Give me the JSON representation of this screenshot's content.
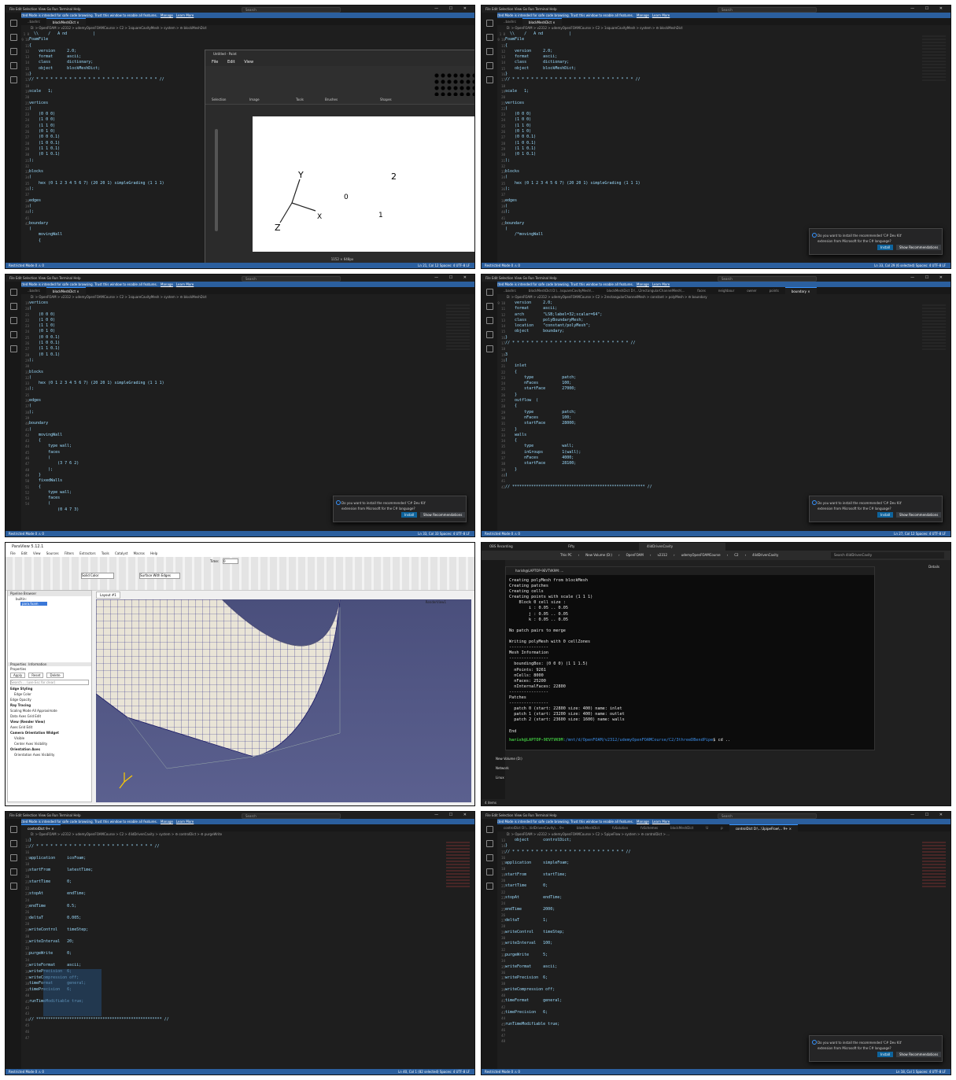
{
  "vscode": {
    "menu": "File  Edit  Selection  View  Go  Run  Terminal  Help",
    "search": "Search",
    "restricted": "Restricted Mode is intended for safe code browsing. Trust this window to enable all features.",
    "manage": "Manage",
    "learn_more": "Learn More",
    "status_left": "Restricted Mode   0 ⚠ 0",
    "toast_line1": "Do you want to install the recommended 'C# Dev Kit'",
    "toast_line2": "extension from Microsoft for the C# language?",
    "install": "Install",
    "show_recs": "Show Recommendations"
  },
  "p1": {
    "tabs": [
      "..bashrc",
      "blockMeshDict ×"
    ],
    "crumb": "D: > OpenFOAM > v2312 > udemyOpenFOAMCourse > C2 > 1squareCavityMesh > system > ⚙ blockMeshDict",
    "gutter": "1\n8\n9\n10\n11\n12\n13\n14\n15\n16\n17\n18\n19\n20\n21\n22\n23\n24\n25\n26\n27\n28\n29\n30\n31\n32\n33\n34\n35\n36\n37\n38\n39\n40\n41\n42",
    "code": "  \\\\    /   A nd           |\nFoamFile\n{\n    version     2.0;\n    format      ascii;\n    class       dictionary;\n    object      blockMeshDict;\n}\n// * * * * * * * * * * * * * * * * * * * * * * * * * * //\n\nscale   1;\n\nvertices\n(\n    (0 0 0)\n    (1 0 0)\n    (1 1 0)\n    (0 1 0)\n    (0 0 0.1)\n    (1 0 0.1)\n    (1 1 0.1)\n    (0 1 0.1)\n);\n\nblocks\n(\n    hex (0 1 2 3 4 5 6 7) (20 20 1) simpleGrading (1 1 1)\n);\n\nedges\n(\n);\n\nboundary\n(\n    movingWall\n    {",
    "status": "Ln 21, Col 12   Spaces: 4   UTF-8   LF",
    "paint_title": "Untitled - Paint",
    "paint_menu": "File  Edit  View",
    "paint_groups": [
      "Selection",
      "Image",
      "Tools",
      "Brushes",
      "Shapes"
    ],
    "paint_size": "1152 × 648px",
    "sketch_labels": [
      "Y",
      "Z",
      "X",
      "0",
      "1",
      "2"
    ]
  },
  "p2": {
    "tabs": [
      "..bashrc",
      "blockMeshDict ×"
    ],
    "crumb": "D: > OpenFOAM > v2312 > udemyOpenFOAMCourse > C2 > 1squareCavityMesh > system > ⚙ blockMeshDict",
    "gutter": "1\n8\n9\n10\n11\n12\n13\n14\n15\n16\n17\n18\n19\n20\n21\n22\n23\n24\n25\n26\n27\n28\n29\n30\n31\n32\n33\n34\n35\n36\n37\n38\n39\n40\n41\n42",
    "code": "  \\\\    /   A nd           |\nFoamFile\n{\n    version     2.0;\n    format      ascii;\n    class       dictionary;\n    object      blockMeshDict;\n}\n// * * * * * * * * * * * * * * * * * * * * * * * * * * //\n\nscale   1;\n\nvertices\n(\n    (0 0 0)\n    (1 0 0)\n    (1 1 0)\n    (0 1 0)\n    (0 0 0.1)\n    (1 0 0.1)\n    (1 1 0.1)\n    (0 1 0.1)\n);\n\nblocks\n(\n    hex (0 1 2 3 4 5 6 7) (20 20 1) simpleGrading (1 1 1)\n);\n\nedges\n(\n);\n\nboundary\n(\n    /*movingWall",
    "status": "Ln 33, Col 29 (6 selected)   Spaces: 4   UTF-8   LF"
  },
  "p3": {
    "tabs": [
      "..bashrc",
      "blockMeshDict ×"
    ],
    "crumb": "D: > OpenFOAM > v2312 > udemyOpenFOAMCourse > C2 > 1squareCavityMesh > system > ⚙ blockMeshDict",
    "gutter": "19\n20\n21\n22\n23\n24\n25\n26\n27\n28\n29\n30\n31\n32\n33\n34\n35\n36\n37\n38\n39\n40\n41\n42\n43\n44\n45\n46\n47\n48\n49\n50\n51\n52\n53\n54",
    "code": "vertices\n(\n    (0 0 0)\n    (1 0 0)\n    (1 1 0)\n    (0 1 0)\n    (0 0 0.1)\n    (1 0 0.1)\n    (1 1 0.1)\n    (0 1 0.1)\n);\n\nblocks\n(\n    hex (0 1 2 3 4 5 6 7) (20 20 1) simpleGrading (1 1 1)\n);\n\nedges\n(\n);\n\nboundary\n(\n    movingWall\n    {\n        type wall;\n        faces\n        (\n            (3 7 6 2)\n        );\n    }\n    fixedWalls\n    {\n        type wall;\n        faces\n        (\n            (0 4 7 3)",
    "status": "Ln 33, Col 33   Spaces: 4   UTF-8   LF"
  },
  "p4": {
    "tabs": [
      "..bashrc",
      "blockMeshDict D:\\...\\squareCavityMesh\\...",
      "blockMeshDict D:\\...\\2rectangularChannelMesh\\...",
      "faces",
      "neighbour",
      "owner",
      "points",
      "boundary ×"
    ],
    "crumb": "D: > OpenFOAM > v2312 > udemyOpenFOAMCourse > C2 > 2rectangularChannelMesh > constant > polyMesh > ⚙ boundary",
    "gutter": "9\n10\n11\n12\n13\n14\n15\n16\n17\n18\n19\n20\n21\n22\n23\n24\n25\n26\n27\n28\n29\n30\n31\n32\n33\n34\n35\n36\n37\n38\n39\n40\n41\n42",
    "code": "    version     2.0;\n    format      ascii;\n    arch        \"LSB;label=32;scalar=64\";\n    class       polyBoundaryMesh;\n    location    \"constant/polyMesh\";\n    object      boundary;\n}\n// * * * * * * * * * * * * * * * * * * * * * * * * * //\n\n3\n(\n    inlet\n    {\n        type            patch;\n        nFaces          100;\n        startFace       27000;\n    }\n    outflow  (\n    {\n        type            patch;\n        nFaces          100;\n        startFace       28000;\n    }\n    walls\n    {\n        type            wall;\n        inGroups        1(wall);\n        nFaces          4000;\n        startFace       28100;\n    }\n)\n\n// ******************************************************** //",
    "status": "Ln 27, Col 12   Spaces: 4   UTF-8   LF"
  },
  "p5": {
    "title": "ParaView 5.12.1",
    "menu": "File  Edit  View  Sources  Filters  Extractors  Tools  Catalyst  Macros  Help",
    "time_label": "Time:",
    "time_value": "0",
    "pipeline_header": "Pipeline Browser",
    "builtin": "builtin:",
    "source": "para.foam",
    "props_tab": "Properties",
    "info_tab": "Information",
    "props_label": "Properties",
    "apply": "Apply",
    "reset": "Reset",
    "delete": "Delete",
    "search_ph": "Search ... (use Esc for clear)",
    "rows": [
      "Edge Styling",
      "Edge Color",
      "Edge Opacity",
      "Ray Tracing",
      "Scaling Mode  All Approximate",
      "Data Axes Grid      Edit",
      "View (Render View)",
      "Axes Grid      Edit",
      "Camera Orientation Widget",
      "Visible",
      "Center Axes Visibility",
      "Orientation Axes",
      "Orientation Axes Visibility"
    ],
    "render_tab": "Layout #1",
    "render_view": "RenderView1",
    "repr": "Surface With Edges",
    "solid": "Solid Color"
  },
  "p6": {
    "explorer_tabs": [
      "OBS Recording",
      "Fifty",
      "4lidDrivenCavity"
    ],
    "crumb": [
      "This PC",
      "New Volume (D:)",
      "OpenFOAM",
      "v2312",
      "udemyOpenFOAMCourse",
      "C2",
      "4lidDrivenCavity"
    ],
    "search": "Search 4lidDrivenCavity",
    "details": "Details",
    "term_title": "harish@LAPTOP-9EVTVK9M: ...",
    "term_lines": "Creating polyMesh from blockMesh\nCreating patches\nCreating cells\nCreating points with scale (1 1 1)\n    Block 0 cell size :\n        i : 0.05 .. 0.05\n        j : 0.05 .. 0.05\n        k : 0.05 .. 0.05\n\nNo patch pairs to merge\n\nWriting polyMesh with 0 cellZones\n----------------\nMesh Information\n----------------\n  boundingBox: (0 0 0) (1 1 1.5)\n  nPoints: 9261\n  nCells: 8000\n  nFaces: 25200\n  nInternalFaces: 22800\n----------------\nPatches\n----------------\n  patch 0 (start: 22800 size: 400) name: inlet\n  patch 1 (start: 23200 size: 400) name: outlet\n  patch 2 (start: 23600 size: 1600) name: walls\n\nEnd\n",
    "prompt_user": "harish@LAPTOP-9EVTVK9M",
    "prompt_path": ":/mnt/d/OpenFOAM/v2312/udemyOpenFOAMCourse/C2/3threeDBendPipe",
    "prompt_cmd": "$ cd ..",
    "side_items": [
      "New Volume (D:)",
      "Network",
      "Linux"
    ],
    "footer": "4 items"
  },
  "p7": {
    "tabs": [
      "controlDict 9+ ×"
    ],
    "crumb": "D: > OpenFOAM > v2312 > udemyOpenFOAMCourse > C2 > 4lidDrivenCavity > system > ⚙ controlDict > ⚙ purgeWrite",
    "gutter": "14\n15\n16\n17\n18\n19\n20\n21\n22\n23\n24\n25\n26\n27\n28\n29\n30\n31\n32\n33\n34\n35\n36\n37\n38\n39\n40\n41\n42\n43\n44\n45\n46\n47",
    "code": "}\n// * * * * * * * * * * * * * * * * * * * * * * * * * //\n\napplication     icoFoam;\n\nstartFrom       latestTime;\n\nstartTime       0;\n\nstopAt          endTime;\n\nendTime         0.5;\n\ndeltaT          0.005;\n\nwriteControl    timeStep;\n\nwriteInterval   20;\n\npurgeWrite      0;\n\nwriteFormat     ascii;\nwritePrecision  6;\nwriteCompression off;\ntimeFormat      general;\ntimePrecision   6;\n\nrunTimeModifiable true;\n\n\n// ***************************************************** //",
    "status": "Ln 40, Col 1 (82 selected)   Spaces: 4   UTF-8   LF"
  },
  "p8": {
    "tabs": [
      "controlDict D:\\...\\lidDrivenCavity\\... 9+",
      "blockMeshDict",
      "fvSolution",
      "fvSchemes",
      "blockMeshDict",
      "U",
      "p",
      "controlDict D:\\...\\3pipeFlow\\... 9+ ×"
    ],
    "crumb": "D: > OpenFOAM > v2312 > udemyOpenFOAMCourse > C2 > 5pipeFlow > system > ⚙ controlDict > ...",
    "gutter": "13\n14\n15\n16\n17\n18\n19\n20\n21\n22\n23\n24\n25\n26\n27\n28\n29\n30\n31\n32\n33\n34\n35\n36\n37\n38\n39\n40\n41\n42\n43\n44\n45\n46\n47\n48",
    "code": "    object      controlDict;\n}\n// * * * * * * * * * * * * * * * * * * * * * * * * //\n\napplication     simpleFoam;\n\nstartFrom       startTime;\n\nstartTime       0;\n\nstopAt          endTime;\n\nendTime         2000;\n\ndeltaT          1;\n\nwriteControl    timeStep;\n\nwriteInterval   100;\n\npurgeWrite      5;\n\nwriteFormat     ascii;\n\nwritePrecision  6;\n\nwriteCompression off;\n\ntimeFormat      general;\n\ntimePrecision   6;\n\nrunTimeModifiable true;\n",
    "status": "Ln 18, Col 1   Spaces: 4   UTF-8   LF"
  },
  "colors": {
    "accent": "#2b5f9e",
    "editor_bg": "#1e1e1e",
    "install": "#0e639c"
  }
}
